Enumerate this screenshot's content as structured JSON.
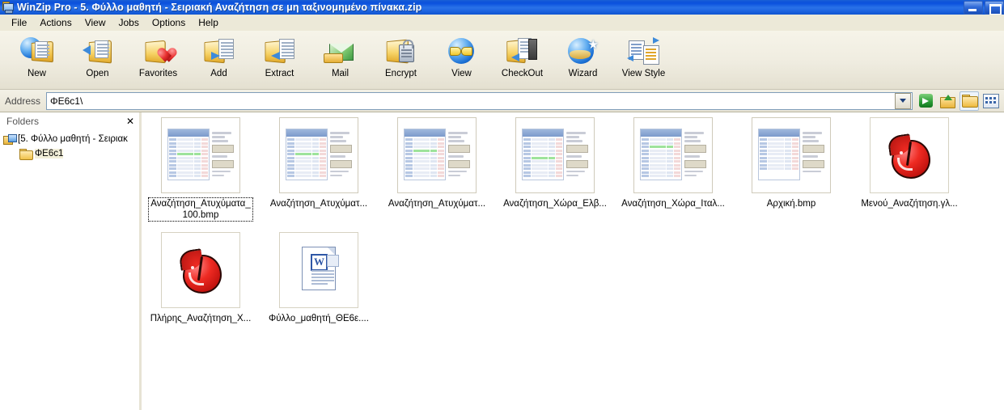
{
  "window": {
    "title": "WinZip Pro - 5. Φύλλο μαθητή - Σειριακή Αναζήτηση σε μη ταξινομημένο πίνακα.zip",
    "icon": "winzip-window-icon",
    "buttons": {
      "minimize": "minimize-button",
      "maximize": "maximize-button",
      "close": "close-button"
    },
    "accent_color": "#0a51dd",
    "chrome_color": "#ece9d8"
  },
  "menu": {
    "items": [
      {
        "label": "File"
      },
      {
        "label": "Actions"
      },
      {
        "label": "View"
      },
      {
        "label": "Jobs"
      },
      {
        "label": "Options"
      },
      {
        "label": "Help"
      }
    ]
  },
  "toolbar": {
    "buttons": [
      {
        "label": "New",
        "icon": "new-archive-icon"
      },
      {
        "label": "Open",
        "icon": "open-archive-icon"
      },
      {
        "label": "Favorites",
        "icon": "favorites-heart-icon"
      },
      {
        "label": "Add",
        "icon": "add-files-icon"
      },
      {
        "label": "Extract",
        "icon": "extract-files-icon"
      },
      {
        "label": "Mail",
        "icon": "mail-envelope-icon"
      },
      {
        "label": "Encrypt",
        "icon": "encrypt-lock-icon"
      },
      {
        "label": "View",
        "icon": "view-glasses-icon"
      },
      {
        "label": "CheckOut",
        "icon": "checkout-icon"
      },
      {
        "label": "Wizard",
        "icon": "wizard-star-icon"
      },
      {
        "label": "View Style",
        "icon": "view-style-icon"
      }
    ]
  },
  "address_bar": {
    "label": "Address",
    "value": "ΦΕ6c1\\",
    "placeholder": "",
    "dropdown_icon": "chevron-down-icon",
    "buttons": [
      {
        "icon": "go-arrow-icon",
        "name": "go-button"
      },
      {
        "icon": "up-folder-icon",
        "name": "up-one-level-button"
      },
      {
        "icon": "open-folder-icon",
        "name": "open-folder-button"
      },
      {
        "icon": "view-style-icon",
        "name": "view-style-button"
      }
    ]
  },
  "folders_pane": {
    "title": "Folders",
    "close_icon": "close-icon",
    "tree": [
      {
        "label": "[5. Φύλλο μαθητή - Σειριακ",
        "icon": "archive-root-icon",
        "level": 0,
        "selected": false
      },
      {
        "label": "ΦΕ6c1",
        "icon": "folder-icon",
        "level": 1,
        "selected": true
      }
    ]
  },
  "file_list": {
    "rows": [
      [
        {
          "label": "Αναζήτηση_Ατυχύματα_\n100.bmp",
          "thumb": "spreadsheet-thumbnail",
          "selected": true
        },
        {
          "label": "Αναζήτηση_Ατυχύματ...",
          "thumb": "spreadsheet-thumbnail",
          "selected": false
        },
        {
          "label": "Αναζήτηση_Ατυχύματ...",
          "thumb": "spreadsheet-thumbnail",
          "selected": false
        },
        {
          "label": "Αναζήτηση_Χώρα_Ελβ...",
          "thumb": "spreadsheet-thumbnail",
          "selected": false
        },
        {
          "label": "Αναζήτηση_Χώρα_Ιταλ...",
          "thumb": "spreadsheet-thumbnail",
          "selected": false
        },
        {
          "label": "Αρχική.bmp",
          "thumb": "spreadsheet-thumbnail",
          "selected": false
        },
        {
          "label": "Μενού_Αναζήτηση.γλ...",
          "thumb": "red-blob-thumbnail",
          "selected": false
        }
      ],
      [
        {
          "label": "Πλήρης_Αναζήτηση_Χ...",
          "thumb": "red-blob-thumbnail",
          "selected": false
        },
        {
          "label": "Φύλλο_μαθητή_ΘΕ6ε....",
          "thumb": "word-document-thumbnail",
          "selected": false
        }
      ]
    ]
  }
}
